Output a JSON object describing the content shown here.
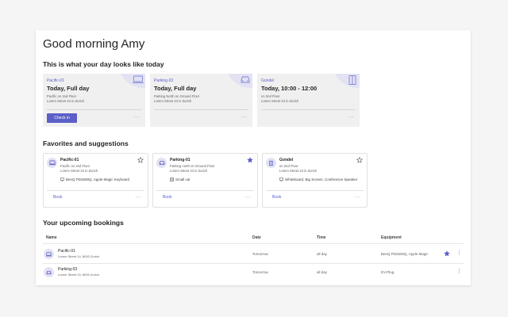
{
  "greeting": "Good morning Amy",
  "sections": {
    "today": "This is what your day looks like today",
    "favorites": "Favorites and suggestions",
    "upcoming": "Your upcoming bookings"
  },
  "today_cards": [
    {
      "name": "Pacific-01",
      "when": "Today, Full day",
      "location": "Pacific on 2nd Floor",
      "address": "Lorem Street 24 in Zurich",
      "action": "Check in",
      "more": "···",
      "icon": "desk-icon"
    },
    {
      "name": "Parking-03",
      "when": "Today, Full day",
      "location": "Parking North on Ground Floor",
      "address": "Lorem Street 24 in Zurich",
      "more": "···",
      "icon": "car-icon"
    },
    {
      "name": "Gondel",
      "when": "Today, 10:00 - 12:00",
      "location": "on 2nd Floor",
      "address": "Lorem Street 24 in Zurich",
      "more": "···",
      "icon": "room-icon"
    }
  ],
  "favorites": [
    {
      "name": "Pacific-01",
      "location": "Pacific on 2nd Floor",
      "address": "Lorem Street 24 in Zurich",
      "equipment": "BenQ PD2500Q, Apple Magic Keyboard",
      "favorited": false,
      "action": "Book",
      "more": "···",
      "icon": "desk-icon"
    },
    {
      "name": "Parking-01",
      "location": "Parking north on Ground Floor",
      "address": "Lorem Street 24 in Zurich",
      "equipment": "Small car",
      "favorited": true,
      "action": "Book",
      "more": "···",
      "icon": "car-icon"
    },
    {
      "name": "Gondel",
      "location": "on 2nd Floor",
      "address": "Lorem Street 24 in Zurich",
      "equipment": "Whiteboard, Big Screen, Conference Speaker",
      "favorited": false,
      "action": "Book",
      "more": "···",
      "icon": "room-icon"
    }
  ],
  "table": {
    "headers": [
      "Name",
      "Date",
      "Time",
      "Equipment"
    ],
    "rows": [
      {
        "name": "Pacific-01",
        "address": "Lorem Street 24, 8000 Zurich",
        "date": "Tomorrow",
        "time": "all day",
        "equipment": "BenQ PD2500Q, Apple Magic",
        "favorited": true,
        "more": "⋮",
        "icon": "desk-icon"
      },
      {
        "name": "Parking-03",
        "address": "Lorem Street 24, 8000 Zurich",
        "date": "Tomorrow",
        "time": "all day",
        "equipment": "EV-Plug",
        "favorited": false,
        "more": "⋮",
        "icon": "car-icon"
      }
    ]
  },
  "colors": {
    "accent": "#5b5fc7",
    "accent_light": "#e3e2f3",
    "card_bg": "#f0f0f0"
  }
}
